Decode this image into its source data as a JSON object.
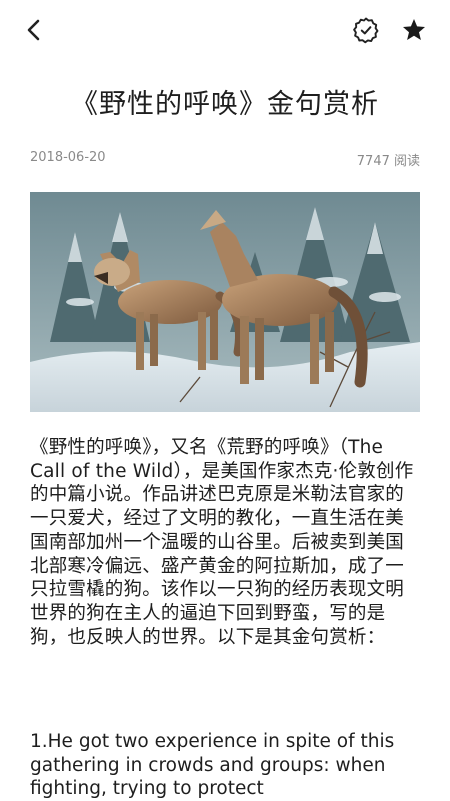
{
  "header": {
    "back_icon": "chevron-left-icon",
    "settings_icon": "gear-badge-icon",
    "favorite_icon": "star-icon"
  },
  "article": {
    "title": "《野性的呼唤》金句赏析",
    "date": "2018-06-20",
    "read_count": "7747 阅读",
    "image_icon": "wolves-in-snow-image",
    "intro": "《野性的呼唤》，又名《荒野的呼唤》（The Call of the Wild），是美国作家杰克·伦敦创作的中篇小说。作品讲述巴克原是米勒法官家的一只爱犬，经过了文明的教化，一直生活在美国南部加州一个温暖的山谷里。后被卖到美国北部寒冷偏远、盛产黄金的阿拉斯加，成了一只拉雪橇的狗。该作以一只狗的经历表现文明世界的狗在主人的逼迫下回到野蛮，写的是狗，也反映人的世界。以下是其金句赏析：",
    "quote_1": "1.He got two experience in spite of this gathering in crowds and groups: when fighting, trying to protect"
  },
  "colors": {
    "text": "#1e1e1e",
    "meta": "#8a8a8a",
    "background": "#ffffff"
  }
}
